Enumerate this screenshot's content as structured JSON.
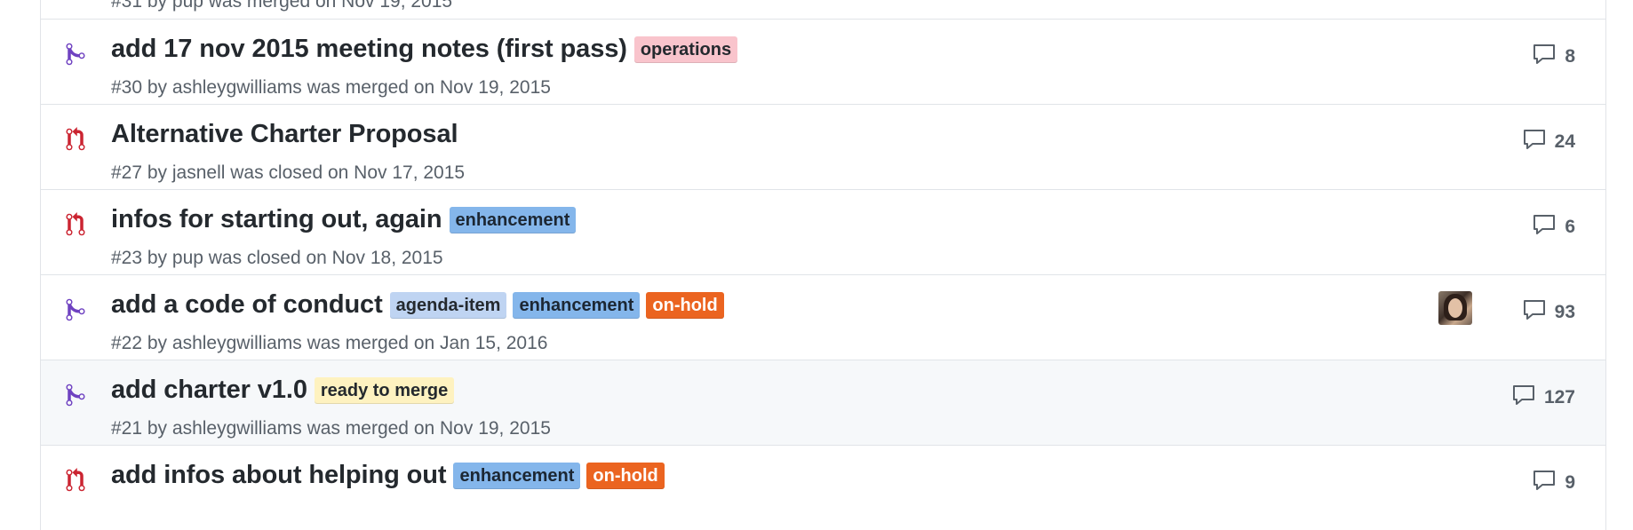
{
  "colors": {
    "merged": "#6f42c1",
    "closed": "#cb2431",
    "muted": "#586069"
  },
  "top_partial_meta": "#31 by pup was merged on Nov 19, 2015",
  "rows": [
    {
      "state": "merged",
      "state_icon": "git-merge-icon",
      "title": "add 17 nov 2015 meeting notes (first pass)",
      "labels": [
        {
          "text": "operations",
          "bg": "#f9c4cc",
          "fg": "#24292e"
        }
      ],
      "meta": "#30 by ashleygwilliams was merged on Nov 19, 2015",
      "comments": "8",
      "avatar": false
    },
    {
      "state": "closed",
      "state_icon": "git-pull-request-closed-icon",
      "title": "Alternative Charter Proposal",
      "labels": [],
      "meta": "#27 by jasnell was closed on Nov 17, 2015",
      "comments": "24",
      "avatar": false
    },
    {
      "state": "closed",
      "state_icon": "git-pull-request-closed-icon",
      "title": "infos for starting out, again",
      "labels": [
        {
          "text": "enhancement",
          "bg": "#84b6eb",
          "fg": "#1c2733"
        }
      ],
      "meta": "#23 by pup was closed on Nov 18, 2015",
      "comments": "6",
      "avatar": false
    },
    {
      "state": "merged",
      "state_icon": "git-merge-icon",
      "title": "add a code of conduct",
      "labels": [
        {
          "text": "agenda-item",
          "bg": "#bfd4f2",
          "fg": "#24292e"
        },
        {
          "text": "enhancement",
          "bg": "#84b6eb",
          "fg": "#1c2733"
        },
        {
          "text": "on-hold",
          "bg": "#eb6420",
          "fg": "#ffffff"
        }
      ],
      "meta": "#22 by ashleygwilliams was merged on Jan 15, 2016",
      "comments": "93",
      "avatar": true
    },
    {
      "state": "merged",
      "state_icon": "git-merge-icon",
      "title": "add charter v1.0",
      "labels": [
        {
          "text": "ready to merge",
          "bg": "#fef2c0",
          "fg": "#24292e"
        }
      ],
      "meta": "#21 by ashleygwilliams was merged on Nov 19, 2015",
      "comments": "127",
      "avatar": false,
      "hover": true
    },
    {
      "state": "closed",
      "state_icon": "git-pull-request-closed-icon",
      "title": "add infos about helping out",
      "labels": [
        {
          "text": "enhancement",
          "bg": "#84b6eb",
          "fg": "#1c2733"
        },
        {
          "text": "on-hold",
          "bg": "#eb6420",
          "fg": "#ffffff"
        }
      ],
      "meta": "",
      "comments": "9",
      "avatar": false
    }
  ]
}
